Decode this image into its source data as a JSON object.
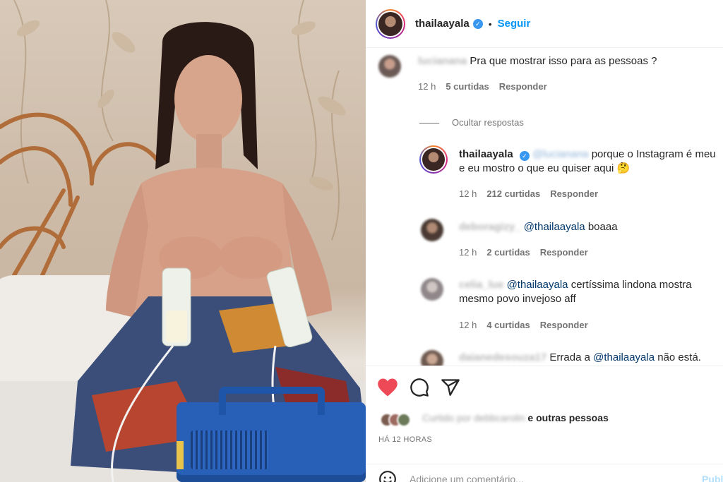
{
  "post": {
    "username": "thailaayala",
    "verified_mark": "✓",
    "separator": "•",
    "follow_label": "Seguir"
  },
  "comments": [
    {
      "author": "lucianana",
      "text": "Pra que mostrar isso para as pessoas ?",
      "time": "12 h",
      "likes": "5 curtidas",
      "reply": "Responder"
    }
  ],
  "hide_replies_label": "Ocultar respostas",
  "replies": [
    {
      "author": "thailaayala",
      "mention_blurred": "@lucianana",
      "text_line1": "porque o Instagram é meu",
      "text_line2": "e eu mostro o que eu quiser aqui",
      "emoji": "🤔",
      "time": "12 h",
      "likes": "212 curtidas",
      "reply": "Responder"
    },
    {
      "author": "deboragizy_",
      "mention": "@thailaayala",
      "text": "boaaa",
      "time": "12 h",
      "likes": "2 curtidas",
      "reply": "Responder"
    },
    {
      "author": "celia_lue",
      "mention": "@thailaayala",
      "text_line1": "certíssima lindona mostra",
      "text_line2": "mesmo povo invejoso aff",
      "time": "12 h",
      "likes": "4 curtidas",
      "reply": "Responder"
    },
    {
      "author": "daianedesouza17",
      "text_pre": "Errada a",
      "mention": "@thailaayala",
      "text_post": "não está."
    }
  ],
  "actions": {
    "like_icon": "heart-filled",
    "comment_icon": "comment",
    "share_icon": "paper-plane",
    "liked_by_blurred": "Curtido por debbcarolin",
    "liked_by_suffix": "e outras pessoas",
    "timestamp": "HÁ 12 HORAS",
    "add_comment_placeholder": "Adicione um comentário...",
    "publish_label": "Publi"
  },
  "colors": {
    "like_red": "#ed4956",
    "link_blue": "#0095f6",
    "mention_blue": "#00376b",
    "verified_blue": "#3897f0"
  }
}
